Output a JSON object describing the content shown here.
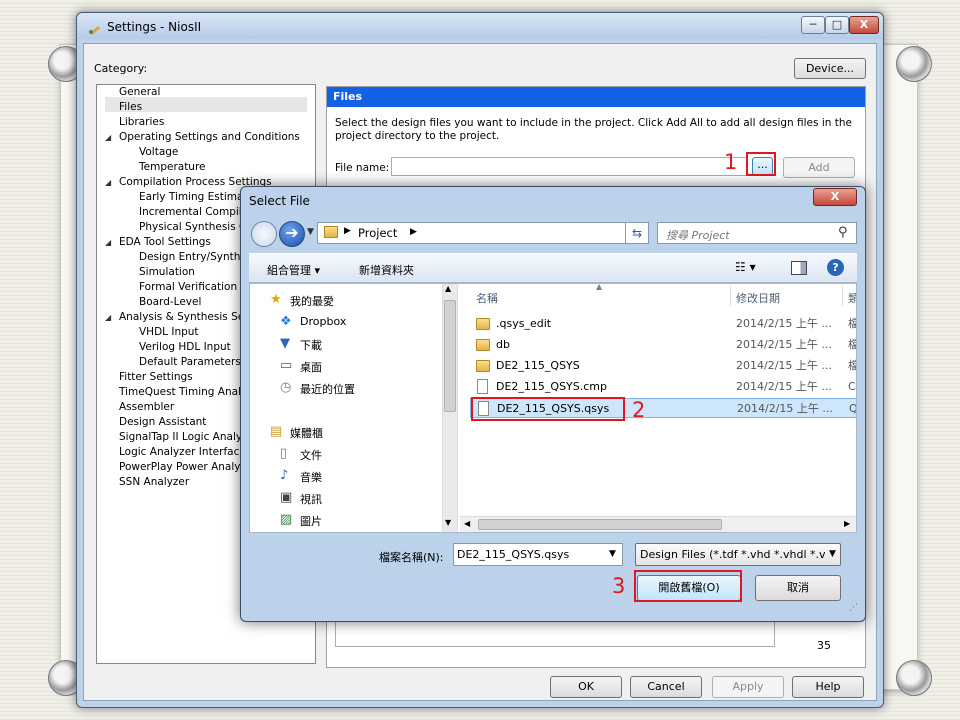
{
  "settings": {
    "title": "Settings - NiosII",
    "category_label": "Category:",
    "device_button": "Device...",
    "minimize": "─",
    "maximize": "□",
    "close": "X",
    "tree": [
      {
        "label": "General",
        "level": 0
      },
      {
        "label": "Files",
        "level": 0,
        "selected": true
      },
      {
        "label": "Libraries",
        "level": 0
      },
      {
        "label": "Operating Settings and Conditions",
        "level": 0,
        "expanded": true
      },
      {
        "label": "Voltage",
        "level": 1
      },
      {
        "label": "Temperature",
        "level": 1
      },
      {
        "label": "Compilation Process Settings",
        "level": 0,
        "expanded": true
      },
      {
        "label": "Early Timing Estimate",
        "level": 1
      },
      {
        "label": "Incremental Compilati",
        "level": 1
      },
      {
        "label": "Physical Synthesis Op",
        "level": 1
      },
      {
        "label": "EDA Tool Settings",
        "level": 0,
        "expanded": true
      },
      {
        "label": "Design Entry/Synthes",
        "level": 1
      },
      {
        "label": "Simulation",
        "level": 1
      },
      {
        "label": "Formal Verification",
        "level": 1
      },
      {
        "label": "Board-Level",
        "level": 1
      },
      {
        "label": "Analysis & Synthesis Setti",
        "level": 0,
        "expanded": true
      },
      {
        "label": "VHDL Input",
        "level": 1
      },
      {
        "label": "Verilog HDL Input",
        "level": 1
      },
      {
        "label": "Default Parameters",
        "level": 1
      },
      {
        "label": "Fitter Settings",
        "level": 0
      },
      {
        "label": "TimeQuest Timing Analyze",
        "level": 0
      },
      {
        "label": "Assembler",
        "level": 0
      },
      {
        "label": "Design Assistant",
        "level": 0
      },
      {
        "label": "SignalTap II Logic Analyze",
        "level": 0
      },
      {
        "label": "Logic Analyzer Interface",
        "level": 0
      },
      {
        "label": "PowerPlay Power Analyze",
        "level": 0
      },
      {
        "label": "SSN Analyzer",
        "level": 0
      }
    ],
    "files_panel": {
      "header": "Files",
      "description": "Select the design files you want to include in the project. Click Add All to add all design files in the project directory to the project.",
      "filename_label": "File name:",
      "browse_button": "...",
      "add_button": "Add",
      "count": "35"
    },
    "bottom_buttons": {
      "ok": "OK",
      "cancel": "Cancel",
      "apply": "Apply",
      "help": "Help"
    }
  },
  "annotations": {
    "step1": "1",
    "step2": "2",
    "step3": "3",
    "color": "#e0171f"
  },
  "select_file": {
    "title": "Select File",
    "close": "X",
    "breadcrumb": "Project",
    "search_placeholder": "搜尋 Project",
    "toolbar": {
      "organize": "組合管理 ▾",
      "new_folder": "新增資料夾"
    },
    "nav": [
      {
        "label": "我的最愛",
        "icon": "star-icon"
      },
      {
        "label": "Dropbox",
        "icon": "dropbox-icon"
      },
      {
        "label": "下載",
        "icon": "download-folder-icon"
      },
      {
        "label": "桌面",
        "icon": "desktop-icon"
      },
      {
        "label": "最近的位置",
        "icon": "recent-places-icon"
      },
      {
        "label": "媒體櫃",
        "icon": "library-icon"
      },
      {
        "label": "文件",
        "icon": "documents-icon"
      },
      {
        "label": "音樂",
        "icon": "music-icon"
      },
      {
        "label": "視訊",
        "icon": "video-icon"
      },
      {
        "label": "圖片",
        "icon": "pictures-icon"
      }
    ],
    "columns": {
      "name": "名稱",
      "date": "修改日期",
      "type": "類"
    },
    "files": [
      {
        "name": ".qsys_edit",
        "date": "2014/2/15 上午 ...",
        "type": "檔",
        "kind": "folder"
      },
      {
        "name": "db",
        "date": "2014/2/15 上午 ...",
        "type": "檔",
        "kind": "folder"
      },
      {
        "name": "DE2_115_QSYS",
        "date": "2014/2/15 上午 ...",
        "type": "檔",
        "kind": "folder"
      },
      {
        "name": "DE2_115_QSYS.cmp",
        "date": "2014/2/15 上午 ...",
        "type": "Cl",
        "kind": "file"
      },
      {
        "name": "DE2_115_QSYS.qsys",
        "date": "2014/2/15 上午 ...",
        "type": "Q",
        "kind": "file",
        "selected": true
      }
    ],
    "filename_label": "檔案名稱(N):",
    "filename_value": "DE2_115_QSYS.qsys",
    "filter": "Design Files (*.tdf *.vhd *.vhdl *.v",
    "open_button": "開啟舊檔(O)",
    "cancel_button": "取消"
  }
}
